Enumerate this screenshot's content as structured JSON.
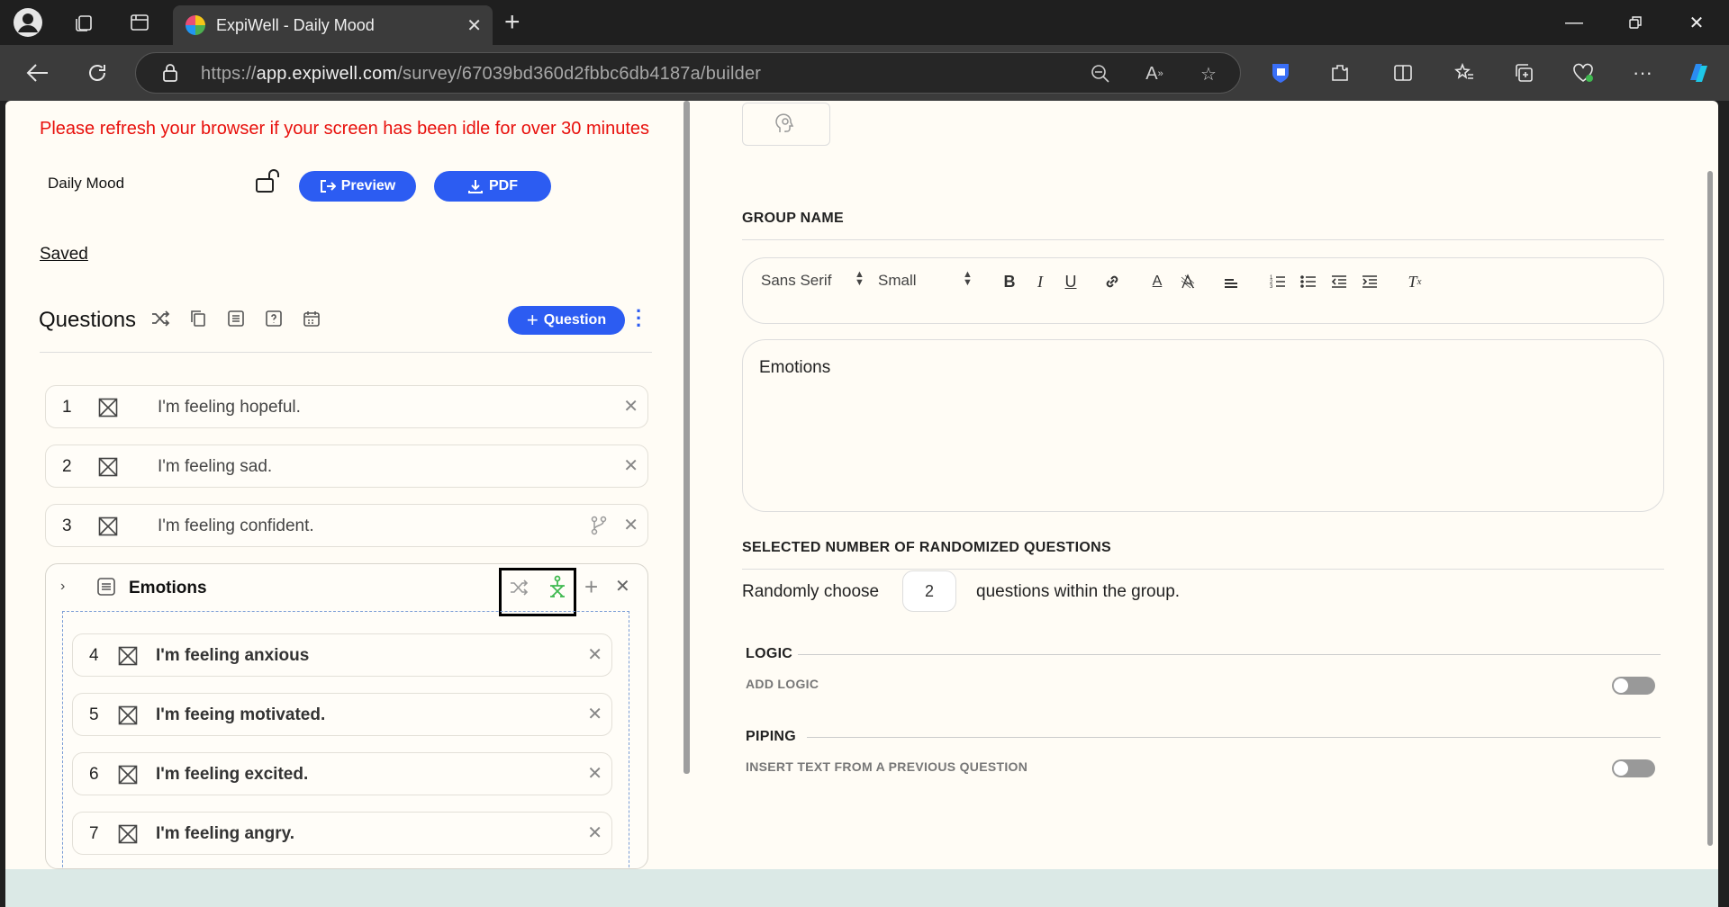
{
  "browser": {
    "tab_title": "ExpiWell - Daily Mood",
    "url_prefix": "https://",
    "url_domain": "app.expiwell.com",
    "url_path": "/survey/67039bd360d2fbbc6db4187a/builder"
  },
  "header": {
    "notice": "Please refresh your browser if your screen has been idle for over 30 minutes",
    "survey_name": "Daily Mood",
    "preview_label": "Preview",
    "pdf_label": "PDF",
    "saved_label": "Saved"
  },
  "questions": {
    "title": "Questions",
    "add_label": "Question",
    "items": [
      {
        "num": "1",
        "text": "I'm feeling hopeful."
      },
      {
        "num": "2",
        "text": "I'm feeling sad."
      },
      {
        "num": "3",
        "text": "I'm feeling confident."
      }
    ],
    "group": {
      "title": "Emotions",
      "items": [
        {
          "num": "4",
          "text": "I'm feeling anxious"
        },
        {
          "num": "5",
          "text": "I'm feeing motivated."
        },
        {
          "num": "6",
          "text": "I'm feeling excited."
        },
        {
          "num": "7",
          "text": "I'm feeling angry."
        }
      ]
    }
  },
  "right": {
    "group_name_label": "GROUP NAME",
    "font_select": "Sans Serif",
    "size_select": "Small",
    "editor_text": "Emotions",
    "randomized_label": "SELECTED NUMBER OF RANDOMIZED QUESTIONS",
    "rand_prefix": "Randomly choose",
    "rand_value": "2",
    "rand_suffix": "questions within the group.",
    "logic_label": "LOGIC",
    "add_logic_label": "ADD LOGIC",
    "piping_label": "PIPING",
    "piping_sub": "INSERT TEXT FROM A PREVIOUS QUESTION"
  },
  "colors": {
    "accent": "#2c5cf2",
    "notice": "#e8100c",
    "page_bg": "#fffcf5"
  }
}
